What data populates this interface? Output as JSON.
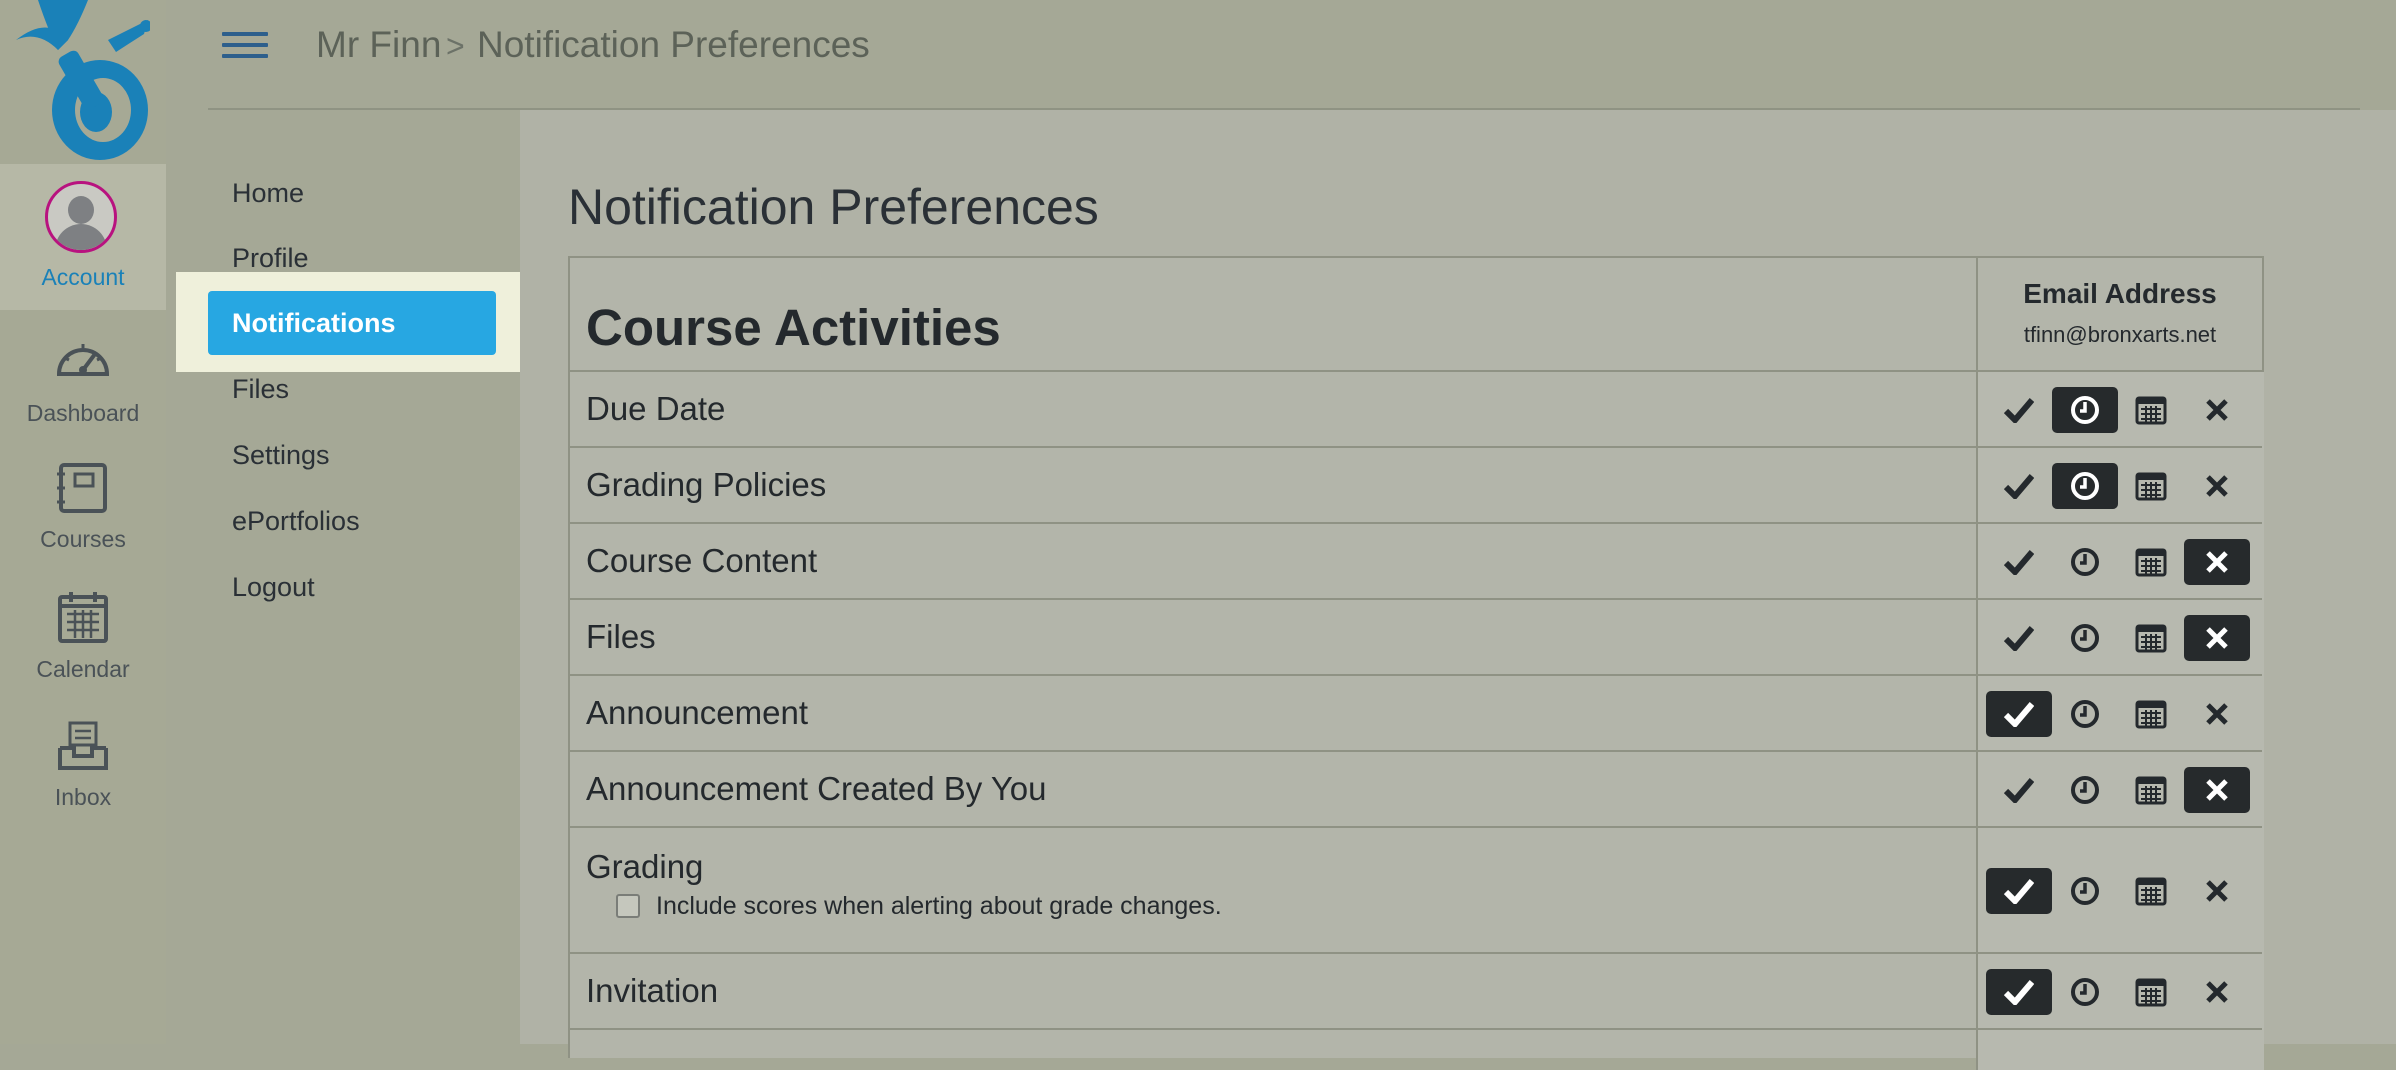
{
  "global_nav": {
    "items": [
      {
        "label": "Account",
        "icon": "avatar"
      },
      {
        "label": "Dashboard",
        "icon": "dashboard-icon"
      },
      {
        "label": "Courses",
        "icon": "courses-icon"
      },
      {
        "label": "Calendar",
        "icon": "calendar-icon"
      },
      {
        "label": "Inbox",
        "icon": "inbox-icon"
      }
    ]
  },
  "header": {
    "breadcrumb": [
      "Mr Finn",
      "Notification Preferences"
    ],
    "separator": ">"
  },
  "subnav": {
    "items": [
      "Home",
      "Profile",
      "Notifications",
      "Files",
      "Settings",
      "ePortfolios",
      "Logout"
    ],
    "active": "Notifications"
  },
  "main": {
    "title": "Notification Preferences",
    "section_title": "Course Activities",
    "email_label": "Email Address",
    "email_address": "tfinn@bronxarts.net",
    "rows": [
      {
        "name": "Due Date",
        "selected": "daily"
      },
      {
        "name": "Grading Policies",
        "selected": "daily"
      },
      {
        "name": "Course Content",
        "selected": "never"
      },
      {
        "name": "Files",
        "selected": "never"
      },
      {
        "name": "Announcement",
        "selected": "immediately"
      },
      {
        "name": "Announcement Created By You",
        "selected": "never"
      },
      {
        "name": "Grading",
        "selected": "immediately",
        "option": "Include scores when alerting about grade changes.",
        "option_checked": false
      },
      {
        "name": "Invitation",
        "selected": "immediately"
      }
    ],
    "frequency_options": [
      "immediately",
      "daily",
      "weekly",
      "never"
    ]
  },
  "colors": {
    "accent": "#27a7e2",
    "selected_option": "#262a2c",
    "avatar_ring": "#b8127f",
    "link": "#1a81b8"
  }
}
